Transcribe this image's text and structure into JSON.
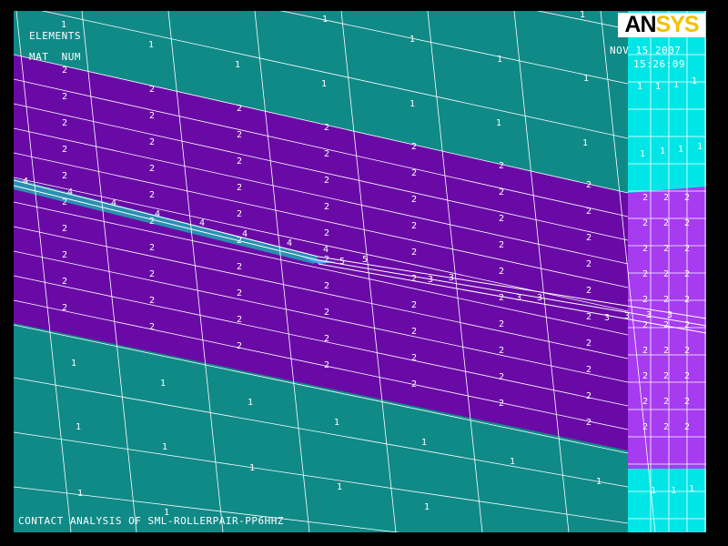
{
  "window": {
    "background": "#000000",
    "logo": {
      "part1": "AN",
      "part2": "SYS",
      "color_dark": "#000000",
      "color_accent": "#f2c200"
    },
    "plot_type": "ELEMENTS",
    "label_mode": "MAT  NUM",
    "date": "NOV 15 2007",
    "time": "15:26:09",
    "title": "CONTACT ANALYSIS OF SML-ROLLERPAIR-PP6HHZ"
  },
  "materials": {
    "1": {
      "name": "1",
      "color": "#0f8a87"
    },
    "2": {
      "name": "2",
      "color": "#6a0aa6"
    },
    "3": {
      "name": "3",
      "color": "#6a0aa6"
    },
    "4": {
      "name": "4",
      "color": "#2a8fb0"
    },
    "5": {
      "name": "5",
      "color": "#4aa6ff"
    },
    "1b": {
      "name": "1",
      "color": "#00e6e6"
    },
    "2b": {
      "name": "2",
      "color": "#a63bf0"
    }
  },
  "mesh_line_color": "#ffffff",
  "label_color": "#ffffff"
}
